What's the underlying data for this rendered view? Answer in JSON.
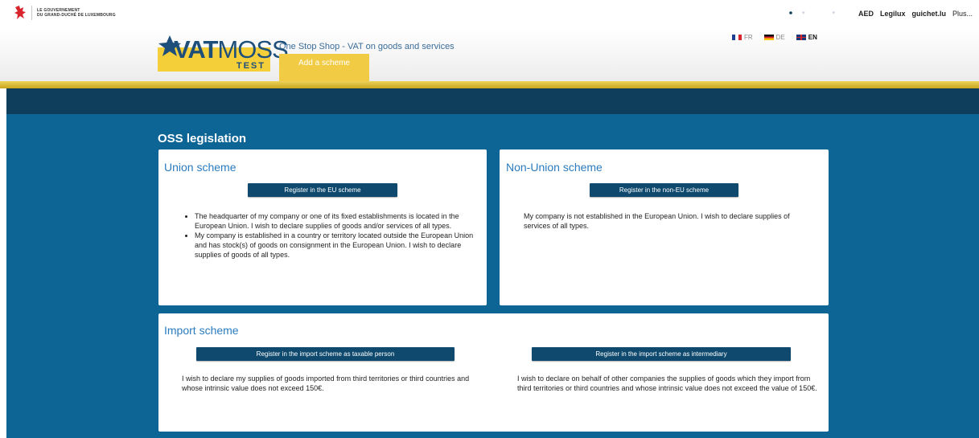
{
  "gov_bar": {
    "gov_line1": "LE GOUVERNEMENT",
    "gov_line2": "DU GRAND-DUCHÉ DE LUXEMBOURG",
    "links": [
      "AED",
      "Legilux",
      "guichet.lu",
      "Plus..."
    ]
  },
  "header": {
    "logo_vat": "VAT",
    "logo_moss": "MOSS",
    "logo_test": "TEST",
    "tagline": "One Stop Shop - VAT on goods and services",
    "active_tab": "Add a scheme",
    "languages": [
      {
        "code": "FR",
        "active": false
      },
      {
        "code": "DE",
        "active": false
      },
      {
        "code": "EN",
        "active": true
      }
    ]
  },
  "toolbar": {
    "icons": [
      "gear-icon",
      "user-icon"
    ]
  },
  "main": {
    "title": "OSS legislation",
    "union": {
      "title": "Union scheme",
      "button": "Register in the EU scheme",
      "bullets": [
        "The headquarter of my company or one of its fixed establishments is located in the European Union. I wish to declare supplies of goods and/or services of all types.",
        "My company is established in a country or territory located outside the European Union and has stock(s) of goods on consignment in the European Union. I wish to declare supplies of goods of all types."
      ]
    },
    "non_union": {
      "title": "Non-Union scheme",
      "button": "Register in the non-EU scheme",
      "text": "My company is not established in the European Union. I wish to declare supplies of services of all types."
    },
    "import": {
      "title": "Import scheme",
      "taxable": {
        "button": "Register in the import scheme as taxable person",
        "text": "I wish to declare my supplies of goods imported from third territories or third countries and whose intrinsic value does not exceed 150€."
      },
      "intermediary": {
        "button": "Register in the import scheme as intermediary",
        "text": "I wish to declare on behalf of other companies the supplies of goods which they import from third territories or third countries and whose intrinsic value does not exceed the value of 150€."
      }
    }
  },
  "colors": {
    "accent_gold": "#f1cb43",
    "toolbar": "#0e3e5c",
    "background_blue": "#0d6596",
    "button": "#0f4a6e",
    "title_blue": "#2a7bbf"
  }
}
